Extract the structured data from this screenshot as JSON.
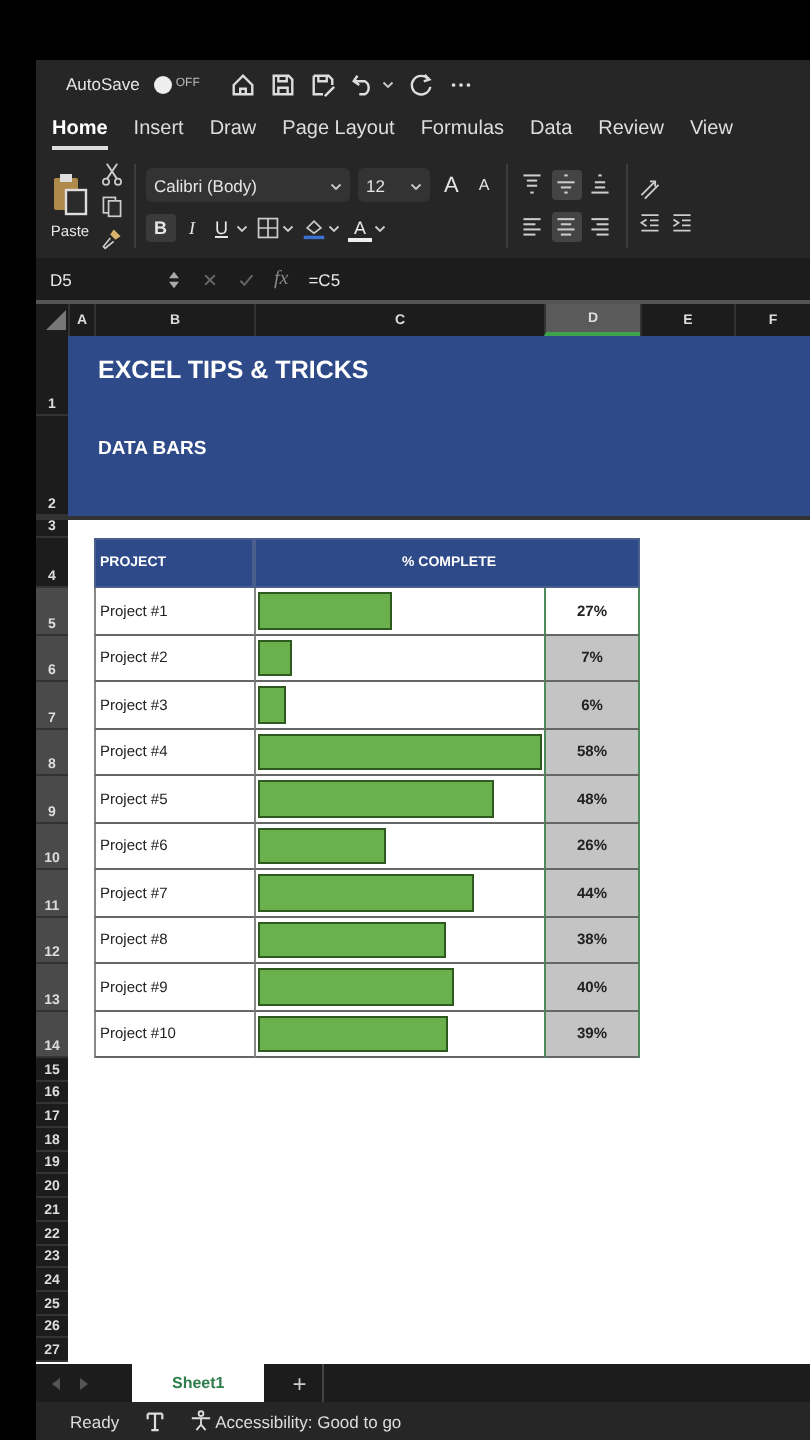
{
  "quick_access": {
    "autosave_label": "AutoSave",
    "autosave_on": false,
    "autosave_state": "OFF"
  },
  "tabs": [
    {
      "label": "Home",
      "selected": true
    },
    {
      "label": "Insert",
      "selected": false
    },
    {
      "label": "Draw",
      "selected": false
    },
    {
      "label": "Page Layout",
      "selected": false
    },
    {
      "label": "Formulas",
      "selected": false
    },
    {
      "label": "Data",
      "selected": false
    },
    {
      "label": "Review",
      "selected": false
    },
    {
      "label": "View",
      "selected": false
    }
  ],
  "ribbon": {
    "paste_label": "Paste",
    "font_name": "Calibri (Body)",
    "font_size": "12",
    "grow_font": "A",
    "shrink_font": "A",
    "bold": "B",
    "italic": "I",
    "underline": "U",
    "font_color": "A",
    "align_buttons": [
      {
        "kind": "top",
        "selected": false
      },
      {
        "kind": "middle",
        "selected": true
      },
      {
        "kind": "bottom",
        "selected": false
      },
      {
        "kind": "left",
        "selected": false
      },
      {
        "kind": "center",
        "selected": true
      },
      {
        "kind": "right",
        "selected": false
      }
    ]
  },
  "formula_bar": {
    "cell": "D5",
    "fx": "fx",
    "formula": "=C5"
  },
  "columns": [
    {
      "label": "A",
      "selected": false
    },
    {
      "label": "B",
      "selected": false
    },
    {
      "label": "C",
      "selected": false
    },
    {
      "label": "D",
      "selected": true
    },
    {
      "label": "E",
      "selected": false
    },
    {
      "label": "F",
      "selected": false
    }
  ],
  "sheet": {
    "band_rows": [
      "1",
      "2"
    ],
    "title": "EXCEL TIPS & TRICKS",
    "subtitle": "DATA BARS",
    "spacer_row": "3",
    "header_row": "4",
    "header_project": "PROJECT",
    "header_complete": "% COMPLETE",
    "rows": [
      {
        "num": "5",
        "name": "Project #1",
        "level": 0.47,
        "value": "27%",
        "selected": true,
        "active": true
      },
      {
        "num": "6",
        "name": "Project #2",
        "level": 0.12,
        "value": "7%",
        "selected": true,
        "active": false
      },
      {
        "num": "7",
        "name": "Project #3",
        "level": 0.1,
        "value": "6%",
        "selected": true,
        "active": false
      },
      {
        "num": "8",
        "name": "Project #4",
        "level": 1.0,
        "value": "58%",
        "selected": true,
        "active": false
      },
      {
        "num": "9",
        "name": "Project #5",
        "level": 0.83,
        "value": "48%",
        "selected": true,
        "active": false
      },
      {
        "num": "10",
        "name": "Project #6",
        "level": 0.45,
        "value": "26%",
        "selected": true,
        "active": false
      },
      {
        "num": "11",
        "name": "Project #7",
        "level": 0.76,
        "value": "44%",
        "selected": true,
        "active": false
      },
      {
        "num": "12",
        "name": "Project #8",
        "level": 0.66,
        "value": "38%",
        "selected": true,
        "active": false
      },
      {
        "num": "13",
        "name": "Project #9",
        "level": 0.69,
        "value": "40%",
        "selected": true,
        "active": false
      },
      {
        "num": "14",
        "name": "Project #10",
        "level": 0.67,
        "value": "39%",
        "selected": true,
        "active": false
      }
    ],
    "empty_rows": [
      "15",
      "16",
      "17",
      "18",
      "19",
      "20",
      "21",
      "22",
      "23",
      "24",
      "25",
      "26",
      "27"
    ]
  },
  "sheet_tabs": [
    {
      "label": "Sheet1",
      "selected": true
    }
  ],
  "add_sheet": "+",
  "status_bar": {
    "ready": "Ready",
    "accessibility": "Accessibility: Good to go"
  }
}
